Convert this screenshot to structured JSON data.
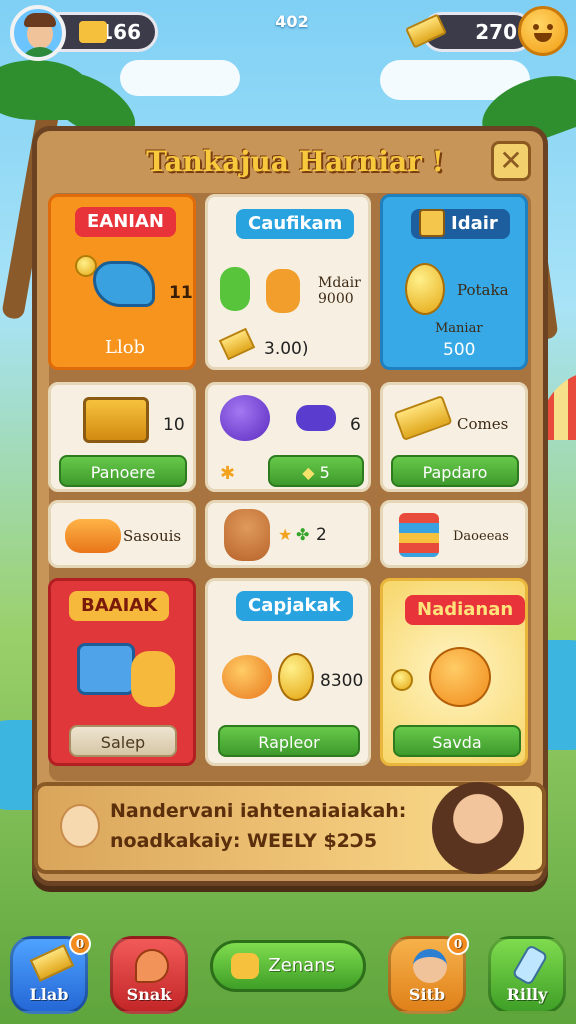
{
  "hud": {
    "xp_value": "166",
    "level": "402",
    "gold_value": "270"
  },
  "panel": {
    "title": "Tankajua Harniar !",
    "close_label": "✕"
  },
  "cards": [
    {
      "tag": "EANIAN",
      "price_label": "11",
      "footer": "Llob"
    },
    {
      "tag": "Caufikam",
      "side_text": "Mdair\n9000",
      "price_label": "3.00)"
    },
    {
      "tag": "Idair",
      "side_text": "Potaka",
      "sub_text": "Maniar",
      "price_label": "500"
    },
    {
      "count": "10",
      "button": "Panoere"
    },
    {
      "count": "6",
      "button": "5"
    },
    {
      "label": "Comes",
      "button": "Papdaro"
    },
    {
      "label": "Sasouis"
    },
    {
      "count": "2"
    },
    {
      "label": "Daoeeas"
    },
    {
      "tag": "BAAIAK",
      "button": "Salep"
    },
    {
      "tag": "Capjakak",
      "count": "8300",
      "button": "Rapleor"
    },
    {
      "tag": "Nadianan",
      "button": "Savda"
    }
  ],
  "banner": {
    "line1": "Nandervani iahtenaiaiakah:",
    "line2": "noadkakaiy: WEELY $2Ɔ5"
  },
  "nav": [
    {
      "label": "Llab",
      "badge": "0"
    },
    {
      "label": "Snak"
    },
    {
      "label": "Zenans"
    },
    {
      "label": "Sitb",
      "badge": "0"
    },
    {
      "label": "Rilly"
    }
  ],
  "colors": {
    "panel_wood": "#c89558",
    "title_gold": "#f8c93d",
    "button_green": "#4fb336",
    "card_orange": "#f7941d",
    "card_blue": "#36a9e6",
    "card_red": "#e0383a"
  }
}
